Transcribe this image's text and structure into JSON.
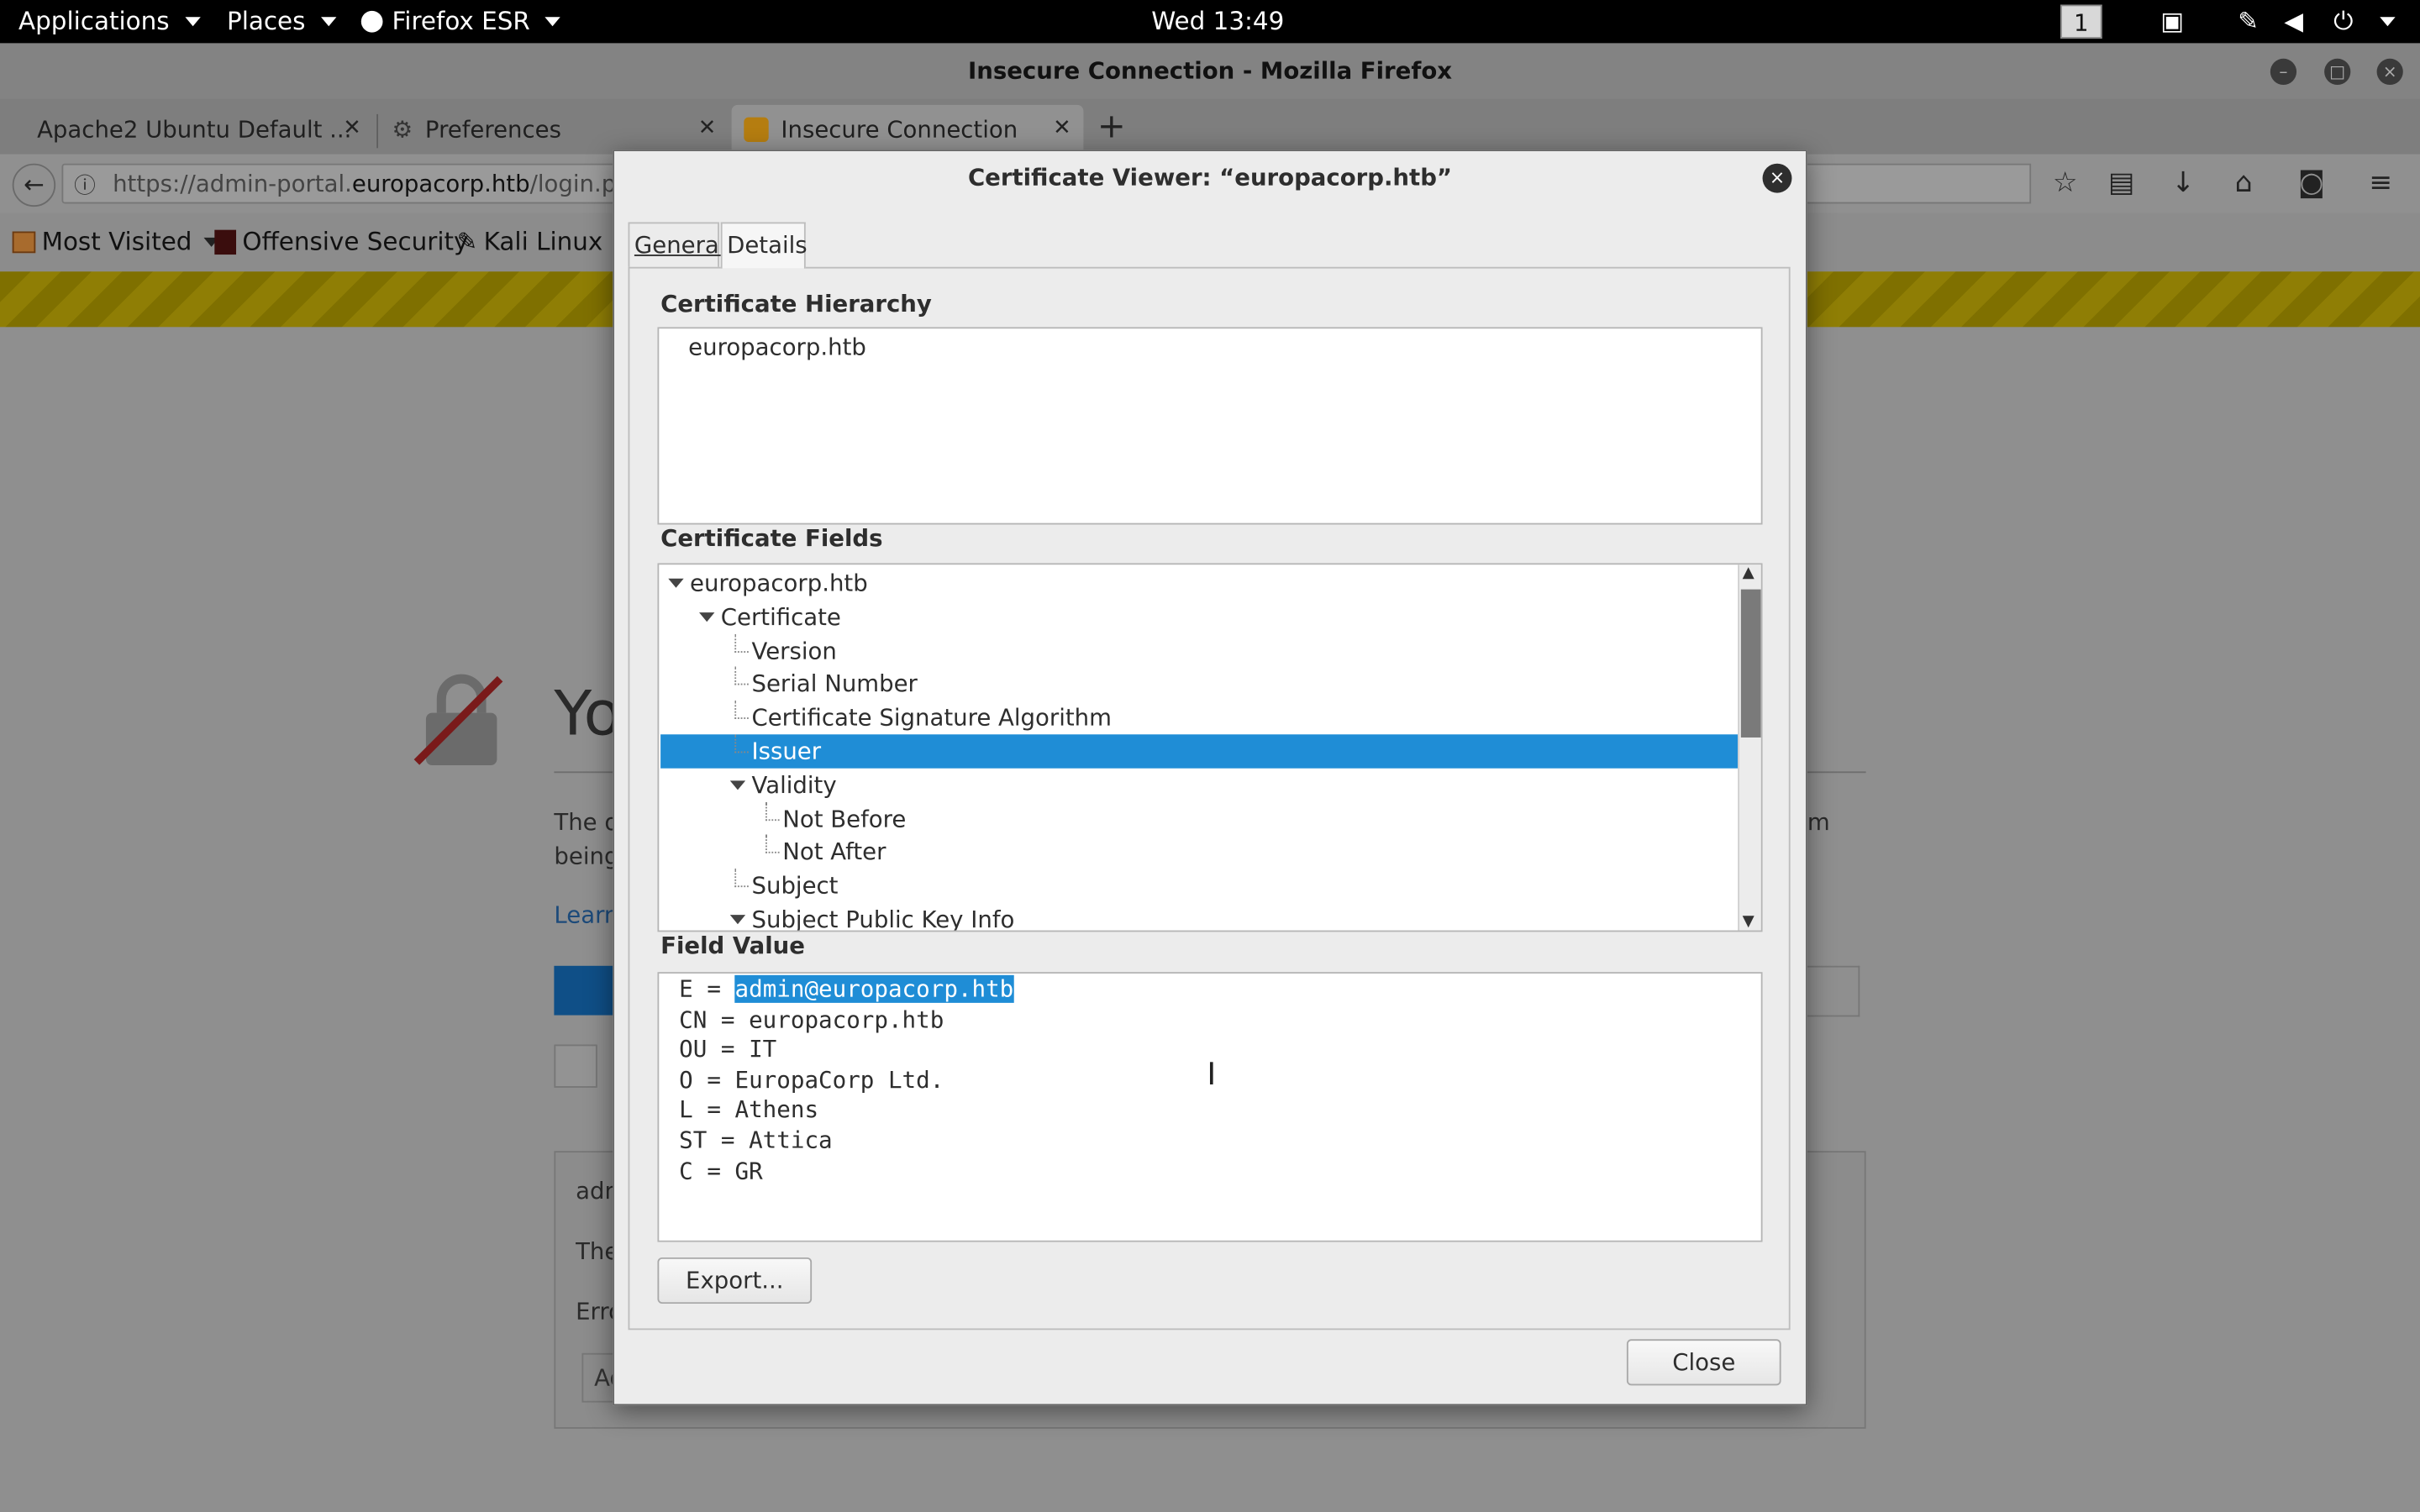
{
  "topbar": {
    "applications": "Applications",
    "places": "Places",
    "firefox": "Firefox ESR",
    "clock": "Wed 13:49",
    "workspace": "1"
  },
  "window": {
    "title": "Insecure Connection - Mozilla Firefox"
  },
  "tabs": [
    {
      "label": "Apache2 Ubuntu Default ..."
    },
    {
      "label": "Preferences"
    },
    {
      "label": "Insecure Connection"
    }
  ],
  "navbar": {
    "url_prefix": "https://admin-portal.",
    "url_domain": "europacorp.htb",
    "url_path": "/login.php"
  },
  "bookmarks": [
    {
      "label": "Most Visited"
    },
    {
      "label": "Offensive Security"
    },
    {
      "label": "Kali Linux"
    }
  ],
  "page": {
    "title_fragment": "Yo",
    "line1_start": "The o",
    "line1_end": "m",
    "line2_start": "being",
    "learn": "Learn",
    "box_line1": "adm",
    "box_line2": "The",
    "box_line3": "Erro",
    "box_input": "Ad"
  },
  "dialog": {
    "title": "Certificate Viewer: “europacorp.htb”",
    "tab_general": "General",
    "tab_details": "Details",
    "hierarchy_label": "Certificate Hierarchy",
    "hierarchy_items": [
      "europacorp.htb"
    ],
    "fields_label": "Certificate Fields",
    "fields": [
      {
        "label": "europacorp.htb",
        "depth": 0,
        "expanded": true
      },
      {
        "label": "Certificate",
        "depth": 1,
        "expanded": true
      },
      {
        "label": "Version",
        "depth": 2
      },
      {
        "label": "Serial Number",
        "depth": 2
      },
      {
        "label": "Certificate Signature Algorithm",
        "depth": 2
      },
      {
        "label": "Issuer",
        "depth": 2,
        "selected": true
      },
      {
        "label": "Validity",
        "depth": 2,
        "expanded": true
      },
      {
        "label": "Not Before",
        "depth": 3
      },
      {
        "label": "Not After",
        "depth": 3
      },
      {
        "label": "Subject",
        "depth": 2
      },
      {
        "label": "Subject Public Key Info",
        "depth": 2,
        "expanded": true
      }
    ],
    "value_label": "Field Value",
    "value_first_prefix": "E = ",
    "value_first_selected": "admin@europacorp.htb",
    "value_lines": [
      "CN = europacorp.htb",
      "OU = IT",
      "O = EuropaCorp Ltd.",
      "L = Athens",
      "ST = Attica",
      "C = GR"
    ],
    "export_button": "Export...",
    "close_button": "Close"
  },
  "colors": {
    "selection": "#1f8dd6",
    "topbar": "#000000",
    "warning_stripe": "#8f7e05"
  }
}
